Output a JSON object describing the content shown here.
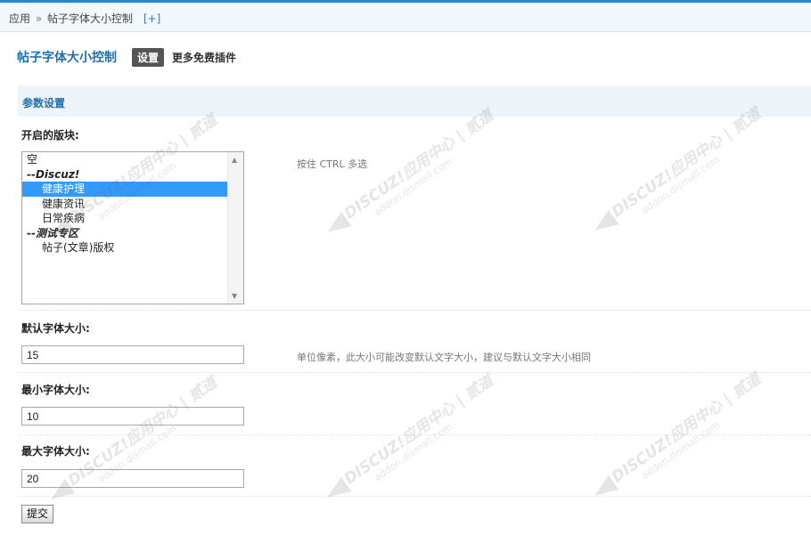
{
  "breadcrumb": {
    "root": "应用",
    "separator": "»",
    "current": "帖子字体大小控制",
    "add": "[+]"
  },
  "plugin": {
    "title": "帖子字体大小控制",
    "tab_settings": "设置",
    "tab_more": "更多免费插件"
  },
  "section": {
    "title": "参数设置"
  },
  "forums": {
    "label": "开启的版块:",
    "hint": "按住 CTRL 多选",
    "options": [
      {
        "text": "空"
      },
      {
        "text": "--Discuz!"
      },
      {
        "text": "健康护理",
        "selected": true
      },
      {
        "text": "健康资讯"
      },
      {
        "text": "日常疾病"
      },
      {
        "text": "--测试专区"
      },
      {
        "text": "帖子(文章)版权"
      }
    ]
  },
  "default_size": {
    "label": "默认字体大小:",
    "value": "15",
    "hint": "单位像素，此大小可能改变默认文字大小，建议与默认文字大小相同"
  },
  "min_size": {
    "label": "最小字体大小:",
    "value": "10"
  },
  "max_size": {
    "label": "最大字体大小:",
    "value": "20"
  },
  "submit": {
    "label": "提交"
  },
  "watermark": {
    "brand": "DISCUZ!应用中心 | 贰道",
    "site": "addon.dismall.com"
  },
  "colors": {
    "accent": "#2b85c5",
    "link": "#1f6fb2",
    "selection": "#3399ff",
    "section_bg": "#edf4fa"
  }
}
